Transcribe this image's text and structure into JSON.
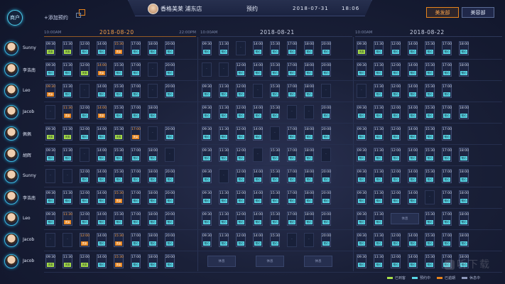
{
  "topbar": {
    "logo_label": "商户",
    "add_label": "+添加预约",
    "store_name": "香格美莱  浦东店",
    "page_title": "预约",
    "date": "2018-07-31",
    "time": "18:06",
    "dept_primary": "美发部",
    "dept_secondary": "美容部"
  },
  "days": [
    {
      "date": "2018-08-20",
      "start": "10:00AM",
      "end": "22:00PM"
    },
    {
      "date": "2018-08-21",
      "start": "10:00AM",
      "end": ""
    },
    {
      "date": "2018-08-22",
      "start": "10:00AM",
      "end": ""
    }
  ],
  "staff": [
    "Sunny",
    "李浩南",
    "Leo",
    "Jacob",
    "佩佩",
    "胡辉",
    "Sunny",
    "李浩南",
    "Leo",
    "Jacob",
    "Jacob"
  ],
  "tags": {
    "cyan": "预约",
    "green": "洗剪",
    "orange": "烫染"
  },
  "rest_label": "休息",
  "legend": [
    {
      "label": "已到客",
      "color": "#a8e04a"
    },
    {
      "label": "预约中",
      "color": "#58d6e6"
    },
    {
      "label": "已逾期",
      "color": "#e8841c"
    },
    {
      "label": "休息中",
      "color": "#8e99bb"
    }
  ],
  "watermark": "听下载",
  "colors": {
    "accent": "#e8841c",
    "cyan": "#58d6e6",
    "green": "#a8e04a"
  }
}
